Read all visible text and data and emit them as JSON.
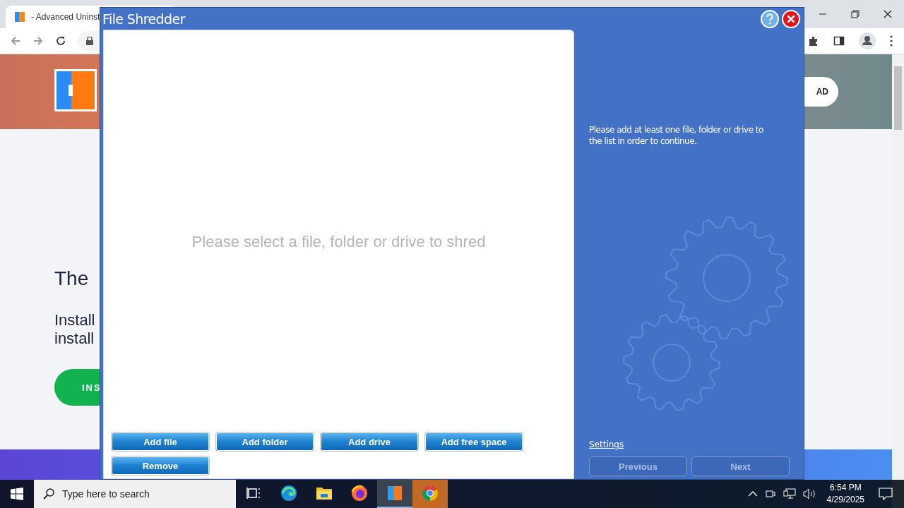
{
  "browser": {
    "tab_title": "- Advanced Uninst",
    "page": {
      "cta_right": "AD",
      "heading": "The",
      "body_lines": [
        "Install",
        "install"
      ],
      "cta_left": "INS"
    }
  },
  "dialog": {
    "title": "File Shredder",
    "empty_message": "Please select a file, folder or drive to shred",
    "add_buttons": [
      "Add file",
      "Add folder",
      "Add drive",
      "Add free space"
    ],
    "remove_button": "Remove",
    "hint": "Please add at least one file, folder or drive to the list in order to continue.",
    "settings_link": "Settings",
    "nav_buttons": [
      {
        "label": "Previous",
        "disabled": true
      },
      {
        "label": "Next",
        "disabled": true
      }
    ]
  },
  "taskbar": {
    "search_placeholder": "Type here to search",
    "apps": [
      {
        "kind": "taskview",
        "selected": false,
        "attention": false
      },
      {
        "kind": "edge",
        "selected": false,
        "attention": false
      },
      {
        "kind": "explorer",
        "selected": false,
        "attention": false
      },
      {
        "kind": "firefox",
        "selected": false,
        "attention": false
      },
      {
        "kind": "uninstaller",
        "selected": true,
        "attention": false
      },
      {
        "kind": "chrome",
        "selected": false,
        "attention": true
      }
    ],
    "time": "6:54 PM",
    "date": "4/29/2025"
  }
}
